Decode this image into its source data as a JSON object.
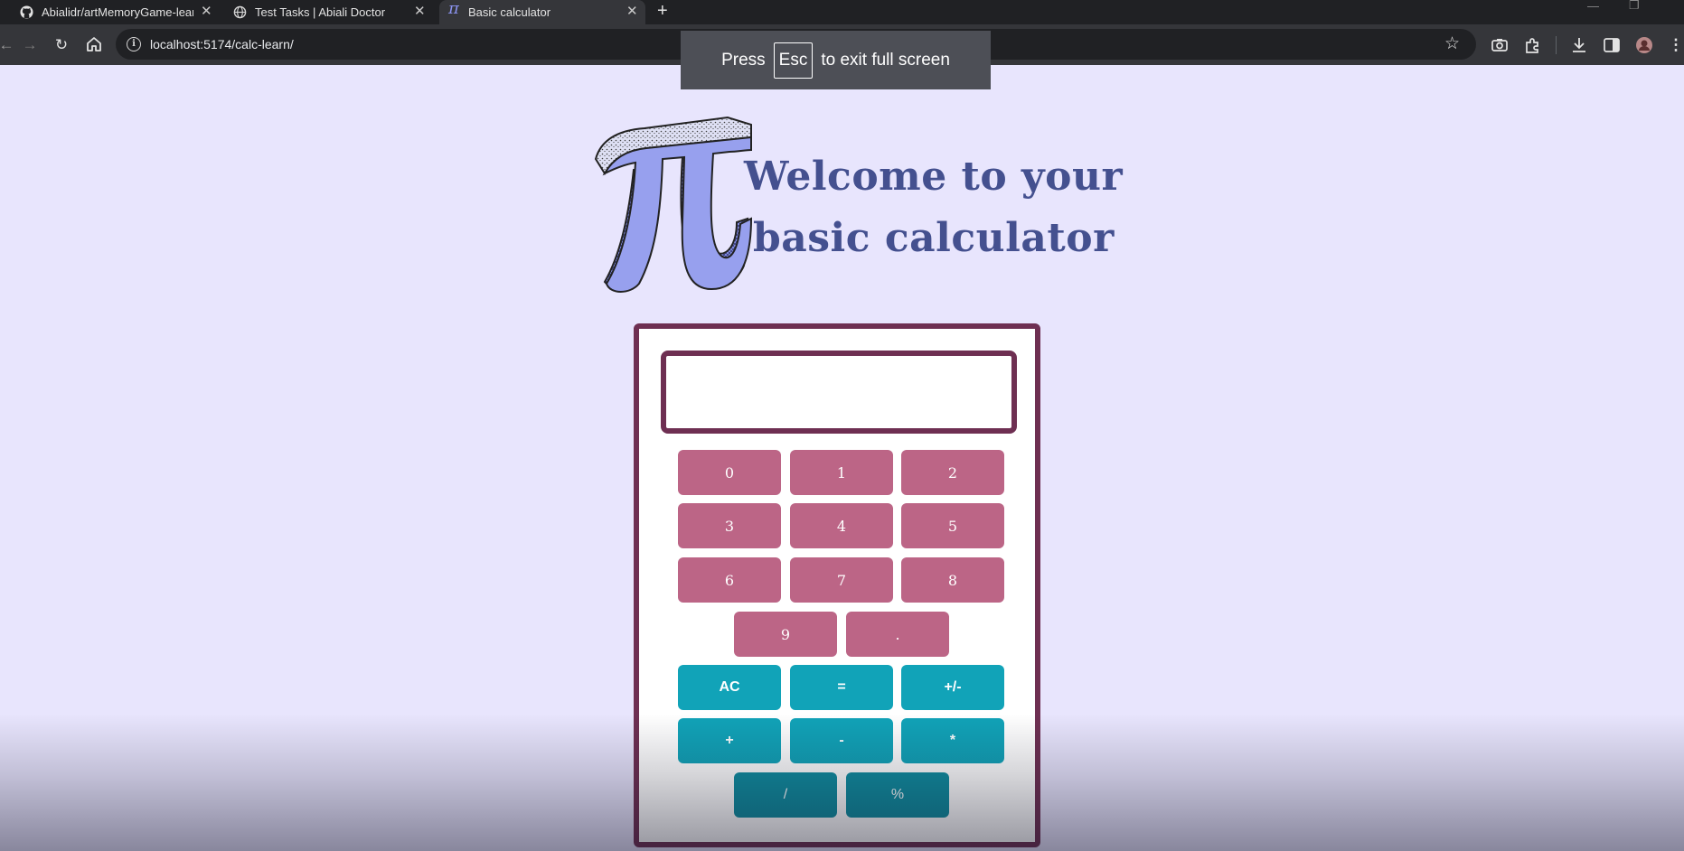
{
  "browser": {
    "tabs": [
      {
        "title": "Abialidr/artMemoryGame-learn",
        "icon": "github-icon"
      },
      {
        "title": "Test Tasks | Abiali Doctor",
        "icon": "globe-icon"
      },
      {
        "title": "Basic calculator",
        "icon": "pi-icon"
      }
    ],
    "close_glyph": "✕",
    "new_tab_glyph": "+",
    "url": "localhost:5174/calc-learn/",
    "fullscreen_toast": {
      "press": "Press",
      "key": "Esc",
      "rest": "to exit full screen"
    }
  },
  "page": {
    "logo_glyph": "π",
    "title_line1": "Welcome to your",
    "title_line2": "basic calculator"
  },
  "calculator": {
    "display_value": "",
    "number_keys": [
      "0",
      "1",
      "2",
      "3",
      "4",
      "5",
      "6",
      "7",
      "8",
      "9",
      "."
    ],
    "operator_keys": [
      "AC",
      "=",
      "+/-",
      "+",
      "-",
      "*",
      "/",
      "%"
    ]
  },
  "colors": {
    "page_bg": "#e8e5fd",
    "title": "#44508f",
    "frame": "#6e2f52",
    "number_key": "#bc6586",
    "operator_key": "#11a3b8",
    "bottom_operator_key": "#0f8c9f"
  }
}
